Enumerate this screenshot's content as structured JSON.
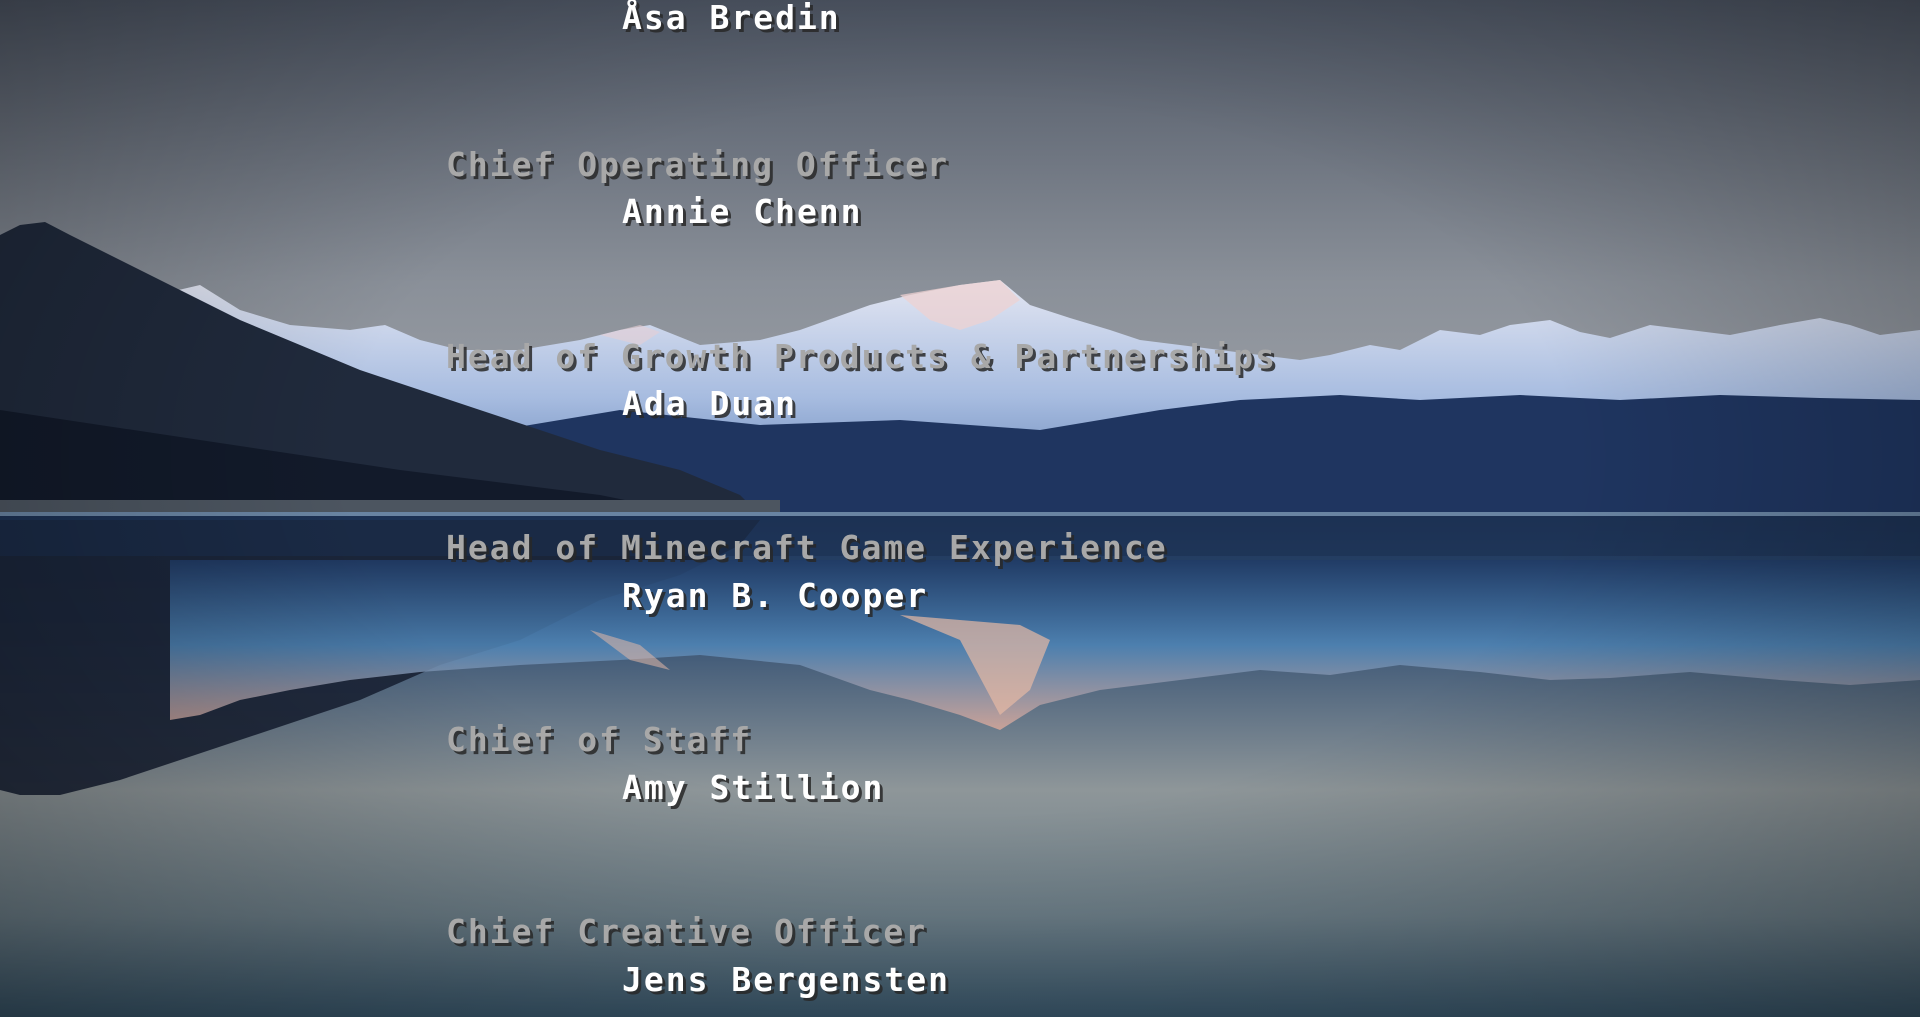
{
  "credits": [
    {
      "name": "Åsa Bredin"
    },
    {
      "role": "Chief Operating Officer",
      "name": "Annie Chenn"
    },
    {
      "role": "Head of Growth Products & Partnerships",
      "name": "Ada Duan"
    },
    {
      "role": "Head of Minecraft Game Experience",
      "name": "Ryan B. Cooper"
    },
    {
      "role": "Chief of Staff",
      "name": "Amy Stillion"
    },
    {
      "role": "Chief Creative Officer",
      "name": "Jens Bergensten"
    }
  ],
  "colors": {
    "role_text": "#a8a8a8",
    "name_text": "#ffffff",
    "text_shadow": "#282828"
  }
}
